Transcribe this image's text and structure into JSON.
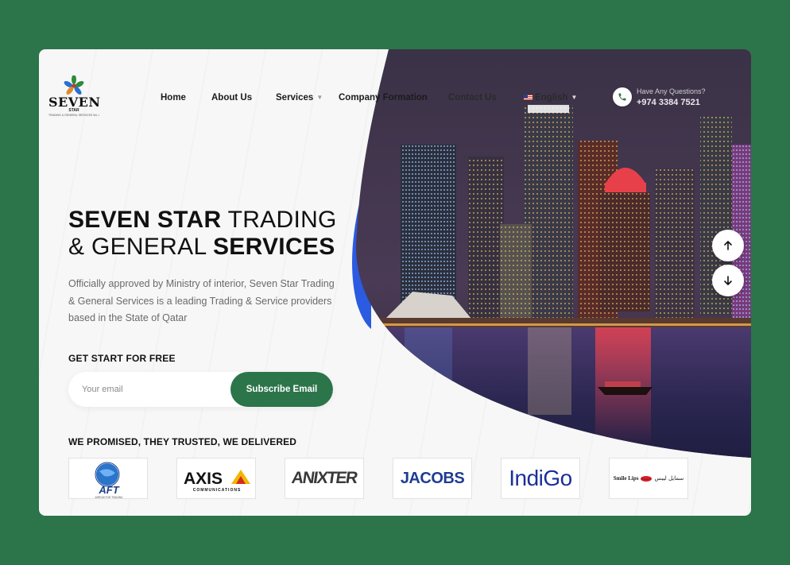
{
  "brand": {
    "name": "SEVEN",
    "sub": "STAR",
    "tagline": "TRADING & GENERAL SERVICES W.L.L"
  },
  "nav": {
    "home": "Home",
    "about": "About Us",
    "services": "Services",
    "company_formation": "Company Formation",
    "contact": "Contact Us",
    "language": "English"
  },
  "contact": {
    "question": "Have Any Questions?",
    "phone": "+974 3384 7521"
  },
  "hero": {
    "title_bold_1": "SEVEN STAR",
    "title_thin_1": " TRADING",
    "title_thin_2": "& GENERAL ",
    "title_bold_2": "SERVICES",
    "description": "Officially approved by Ministry of interior, Seven Star Trading & General Services is a leading Trading & Service providers based in the State of Qatar"
  },
  "subscribe": {
    "heading": "GET START FOR FREE",
    "placeholder": "Your email",
    "button": "Subscribe Email"
  },
  "clients": {
    "heading": "WE PROMISED, THEY TRUSTED, WE DELIVERED",
    "logos": [
      {
        "name": "AFT",
        "sub": "ARROW FOR TRADING"
      },
      {
        "name": "AXIS",
        "sub": "COMMUNICATIONS"
      },
      {
        "name": "ANIXTER"
      },
      {
        "name": "JACOBS"
      },
      {
        "name": "IndiGo"
      },
      {
        "name": "Smile Lips",
        "alt": "سمايل ليبس"
      }
    ]
  },
  "colors": {
    "brand_green": "#2c744a",
    "accent_blue": "#2a5be0"
  },
  "icons": {
    "phone": "phone-icon",
    "scroll_up": "arrow-up-icon",
    "scroll_down": "arrow-down-icon"
  }
}
